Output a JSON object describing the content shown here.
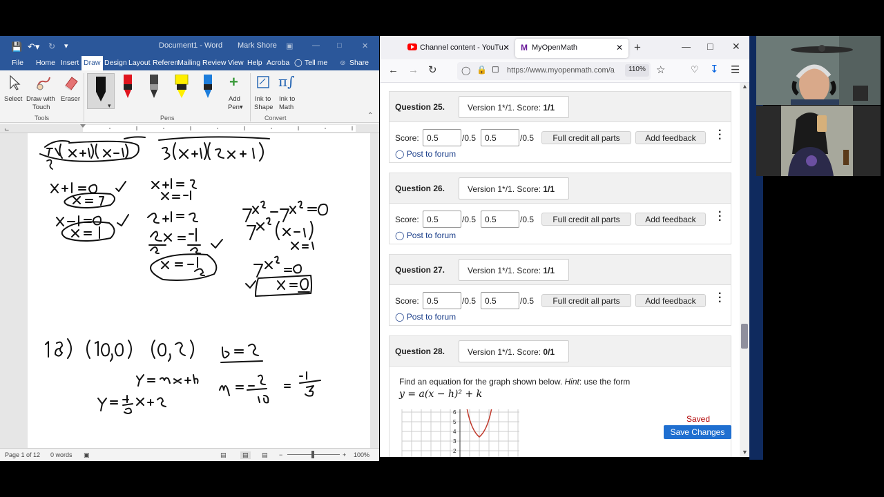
{
  "word": {
    "doc_title": "Document1  -  Word",
    "user": "Mark Shore",
    "menu": [
      "File",
      "Home",
      "Insert",
      "Draw",
      "Design",
      "Layout",
      "Referen",
      "Mailing",
      "Review",
      "View",
      "Help",
      "Acroba"
    ],
    "tell_me": "Tell me",
    "share": "Share",
    "ribbon": {
      "select": "Select",
      "draw_touch_1": "Draw with",
      "draw_touch_2": "Touch",
      "eraser": "Eraser",
      "add_pen_1": "Add",
      "add_pen_2": "Pen",
      "ink_shape_1": "Ink to",
      "ink_shape_2": "Shape",
      "ink_math_1": "Ink to",
      "ink_math_2": "Math",
      "group_tools": "Tools",
      "group_pens": "Pens",
      "group_convert": "Convert"
    },
    "status": {
      "page": "Page 1 of 12",
      "words": "0 words",
      "zoom": "100%"
    }
  },
  "browser": {
    "tab1": "Channel content - YouTube",
    "tab2": "MyOpenMath",
    "url": "https://www.myopenmath.com/a",
    "zoom": "110%"
  },
  "questions": [
    {
      "num": "Question 25.",
      "ver_pre": "Version 1*/1. Score: ",
      "ver_score": "1/1",
      "score1": "0.5",
      "max1": "/0.5",
      "score2": "0.5",
      "max2": "/0.5"
    },
    {
      "num": "Question 26.",
      "ver_pre": "Version 1*/1. Score: ",
      "ver_score": "1/1",
      "score1": "0.5",
      "max1": "/0.5",
      "score2": "0.5",
      "max2": "/0.5"
    },
    {
      "num": "Question 27.",
      "ver_pre": "Version 1*/1. Score: ",
      "ver_score": "1/1",
      "score1": "0.5",
      "max1": "/0.5",
      "score2": "0.5",
      "max2": "/0.5"
    },
    {
      "num": "Question 28.",
      "ver_pre": "Version 1*/1. Score: ",
      "ver_score": "0/1"
    }
  ],
  "common": {
    "score_label": "Score:",
    "full_credit": "Full credit all parts",
    "add_feedback": "Add feedback",
    "post_forum": "Post to forum"
  },
  "q28": {
    "prompt": "Find an equation for the graph shown below. ",
    "hint_label": "Hint",
    "hint_text": ": use the form",
    "formula": "y = a(x − h)² + k",
    "saved": "Saved",
    "save_changes": "Save Changes",
    "y_ticks": [
      "6",
      "5",
      "4",
      "3",
      "2"
    ]
  },
  "colors": {
    "word_blue": "#2b579a",
    "link": "#1a3e8a",
    "save_btn": "#1f6fd0",
    "saved_red": "#b00000"
  }
}
